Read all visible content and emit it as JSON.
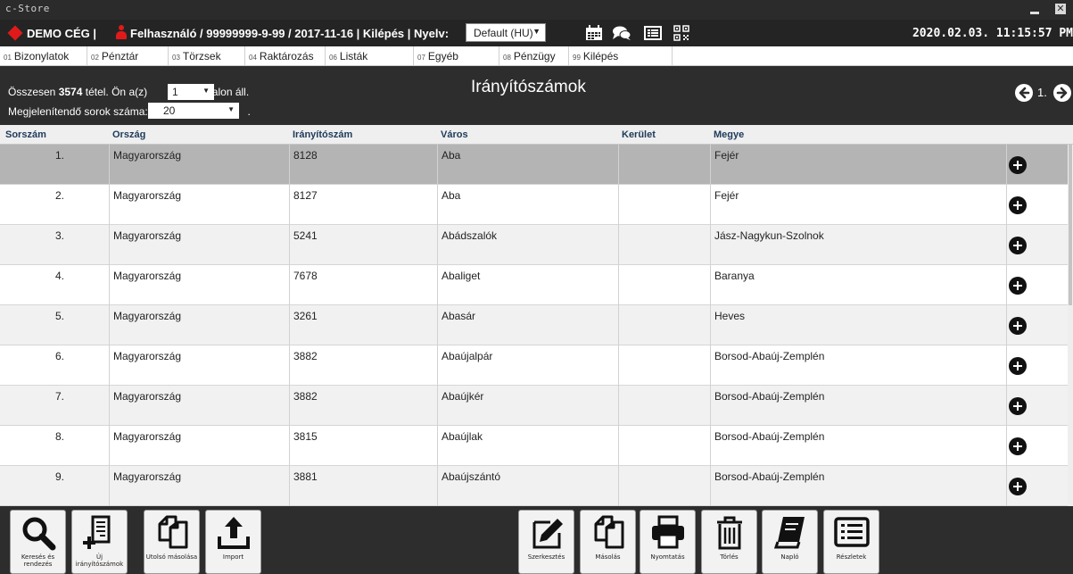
{
  "window": {
    "app_name": "c-Store",
    "close_glyph": "✕"
  },
  "infobar": {
    "company": "DEMO CÉG |",
    "user_text": "Felhasználó / 99999999-9-99 / 2017-11-16 | Kilépés | Nyelv:",
    "language_value": "Default (HU)",
    "datetime": "2020.02.03. 11:15:57 PM",
    "icons": [
      "calendar-icon",
      "chat-icon",
      "list-icon",
      "qr-code-icon"
    ]
  },
  "menu": [
    {
      "num": "01",
      "label": "Bizonylatok"
    },
    {
      "num": "02",
      "label": "Pénztár"
    },
    {
      "num": "03",
      "label": "Törzsek"
    },
    {
      "num": "04",
      "label": "Raktározás"
    },
    {
      "num": "06",
      "label": "Listák"
    },
    {
      "num": "07",
      "label": "Egyéb"
    },
    {
      "num": "08",
      "label": "Pénzügy"
    },
    {
      "num": "99",
      "label": "Kilépés"
    }
  ],
  "header": {
    "total_prefix": "Összesen",
    "total_count": "3574",
    "total_suffix": "tétel. Ön a(z)",
    "page_value": "1",
    "page_suffix": "oldalon áll.",
    "rows_label": "Megjelenítendő sorok száma:",
    "rows_value": "20",
    "rows_after": ".",
    "title": "Irányítószámok",
    "current_page": "1."
  },
  "table": {
    "columns": [
      "Sorszám",
      "Ország",
      "Irányítószám",
      "Város",
      "Kerület",
      "Megye"
    ],
    "rows": [
      {
        "n": "1.",
        "country": "Magyarország",
        "zip": "8128",
        "city": "Aba",
        "district": "",
        "county": "Fejér"
      },
      {
        "n": "2.",
        "country": "Magyarország",
        "zip": "8127",
        "city": "Aba",
        "district": "",
        "county": "Fejér"
      },
      {
        "n": "3.",
        "country": "Magyarország",
        "zip": "5241",
        "city": "Abádszalók",
        "district": "",
        "county": "Jász-Nagykun-Szolnok"
      },
      {
        "n": "4.",
        "country": "Magyarország",
        "zip": "7678",
        "city": "Abaliget",
        "district": "",
        "county": "Baranya"
      },
      {
        "n": "5.",
        "country": "Magyarország",
        "zip": "3261",
        "city": "Abasár",
        "district": "",
        "county": "Heves"
      },
      {
        "n": "6.",
        "country": "Magyarország",
        "zip": "3882",
        "city": "Abaújalpár",
        "district": "",
        "county": "Borsod-Abaúj-Zemplén"
      },
      {
        "n": "7.",
        "country": "Magyarország",
        "zip": "3882",
        "city": "Abaújkér",
        "district": "",
        "county": "Borsod-Abaúj-Zemplén"
      },
      {
        "n": "8.",
        "country": "Magyarország",
        "zip": "3815",
        "city": "Abaújlak",
        "district": "",
        "county": "Borsod-Abaúj-Zemplén"
      },
      {
        "n": "9.",
        "country": "Magyarország",
        "zip": "3881",
        "city": "Abaújszántó",
        "district": "",
        "county": "Borsod-Abaúj-Zemplén"
      }
    ]
  },
  "toolbar": {
    "search": "Keresés és rendezés",
    "new_zip": "Új irányítószámok",
    "copy_last": "Utolsó másolása",
    "import": "Import",
    "edit": "Szerkesztés",
    "copy": "Másolás",
    "print": "Nyomtatás",
    "delete": "Törlés",
    "log": "Napló",
    "details": "Részletek"
  }
}
